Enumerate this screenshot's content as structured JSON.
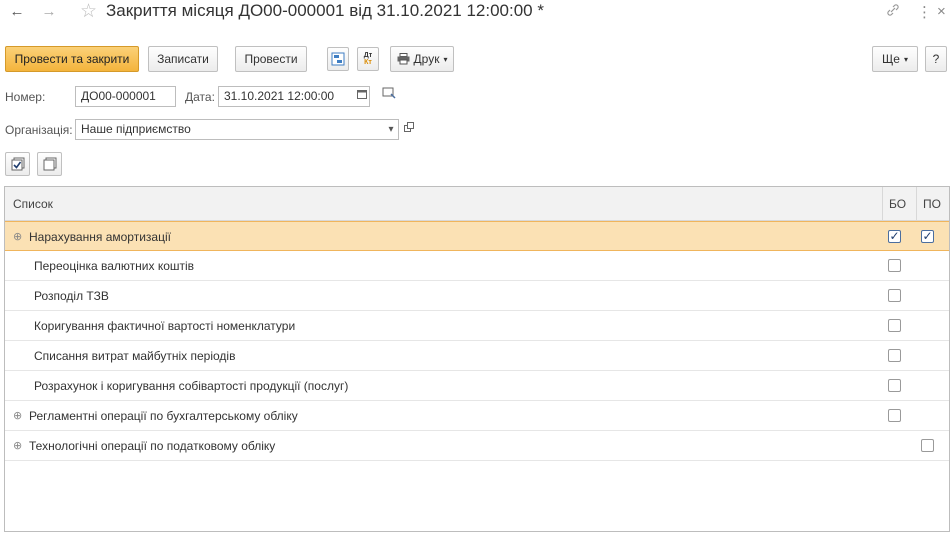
{
  "window": {
    "title": "Закриття місяця ДО00-000001 від 31.10.2021 12:00:00 *",
    "icons": {
      "back": "←",
      "forward": "→",
      "star": "☆",
      "link": "🔗",
      "more": "⋮",
      "close": "×"
    }
  },
  "toolbar": {
    "post_close": "Провести та закрити",
    "save": "Записати",
    "post": "Провести",
    "structure_icon": "document-structure-icon",
    "dtkt_icon": "Дт\nКт",
    "print": "Друк",
    "more": "Ще",
    "help": "?"
  },
  "fields": {
    "number_label": "Номер:",
    "number_value": "ДО00-000001",
    "date_label": "Дата:",
    "date_value": "31.10.2021 12:00:00",
    "org_label": "Організація:",
    "org_value": "Наше підприємство"
  },
  "table": {
    "col_list": "Список",
    "col_bo": "БО",
    "col_po": "ПО",
    "rows": [
      {
        "label": "Нарахування амортизації",
        "group": true,
        "bo": true,
        "po": true,
        "selected": true
      },
      {
        "label": "Переоцінка валютних коштів",
        "group": false,
        "bo": false,
        "po": null,
        "selected": false
      },
      {
        "label": "Розподіл ТЗВ",
        "group": false,
        "bo": false,
        "po": null,
        "selected": false
      },
      {
        "label": "Коригування фактичної вартості номенклатури",
        "group": false,
        "bo": false,
        "po": null,
        "selected": false
      },
      {
        "label": "Списання витрат майбутніх періодів",
        "group": false,
        "bo": false,
        "po": null,
        "selected": false
      },
      {
        "label": "Розрахунок і коригування собівартості продукції (послуг)",
        "group": false,
        "bo": false,
        "po": null,
        "selected": false
      },
      {
        "label": "Регламентні операції по бухгалтерському обліку",
        "group": true,
        "bo": false,
        "po": null,
        "selected": false
      },
      {
        "label": "Технологічні операції по податковому обліку",
        "group": true,
        "bo": null,
        "po": false,
        "selected": false
      }
    ]
  },
  "colors": {
    "accent": "#f4b43c",
    "selection": "#fbe1b4"
  }
}
